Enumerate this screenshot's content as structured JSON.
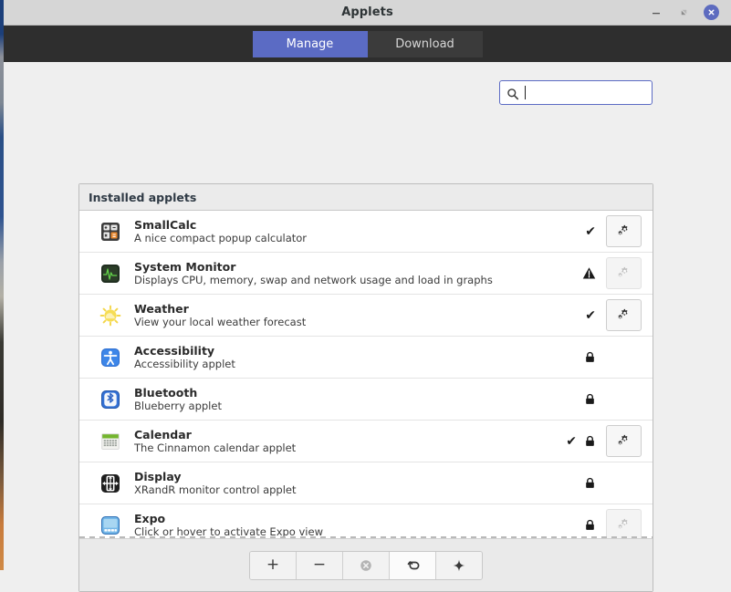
{
  "window": {
    "title": "Applets",
    "controls": {
      "minimize": "minimize",
      "maximize": "maximize",
      "close": "close"
    }
  },
  "tabs": [
    {
      "label": "Manage",
      "active": true
    },
    {
      "label": "Download",
      "active": false
    }
  ],
  "search": {
    "placeholder": "",
    "value": "",
    "icon": "search-icon",
    "focused": true
  },
  "panel": {
    "header": "Installed applets",
    "rows": [
      {
        "name": "SmallCalc",
        "description": "A nice compact popup calculator",
        "icon": "calculator-icon",
        "checked": true,
        "warning": false,
        "locked": false,
        "gear": "enabled"
      },
      {
        "name": "System Monitor",
        "description": "Displays CPU, memory, swap and network usage and load in graphs",
        "icon": "system-monitor-icon",
        "checked": false,
        "warning": true,
        "locked": false,
        "gear": "disabled"
      },
      {
        "name": "Weather",
        "description": "View your local weather forecast",
        "icon": "weather-sun-icon",
        "checked": true,
        "warning": false,
        "locked": false,
        "gear": "enabled"
      },
      {
        "name": "Accessibility",
        "description": "Accessibility applet",
        "icon": "accessibility-icon",
        "checked": false,
        "warning": false,
        "locked": true,
        "gear": "none"
      },
      {
        "name": "Bluetooth",
        "description": "Blueberry applet",
        "icon": "bluetooth-icon",
        "checked": false,
        "warning": false,
        "locked": true,
        "gear": "none"
      },
      {
        "name": "Calendar",
        "description": "The Cinnamon calendar applet",
        "icon": "calendar-icon",
        "checked": true,
        "warning": false,
        "locked": true,
        "gear": "enabled"
      },
      {
        "name": "Display",
        "description": "XRandR monitor control applet",
        "icon": "display-icon",
        "checked": false,
        "warning": false,
        "locked": true,
        "gear": "none"
      },
      {
        "name": "Expo",
        "description": "Click or hover to activate Expo view",
        "icon": "expo-icon",
        "checked": false,
        "warning": false,
        "locked": true,
        "gear": "disabled"
      }
    ]
  },
  "toolbar": {
    "buttons": [
      {
        "name": "add-applet-button",
        "icon": "plus-icon",
        "glyph": "+",
        "state": "normal"
      },
      {
        "name": "remove-applet-button",
        "icon": "minus-icon",
        "glyph": "−",
        "state": "normal"
      },
      {
        "name": "uninstall-applet-button",
        "icon": "circle-x-icon",
        "glyph": "",
        "state": "disabled"
      },
      {
        "name": "restore-defaults-button",
        "icon": "undo-arrow-icon",
        "glyph": "",
        "state": "hover"
      },
      {
        "name": "highlight-applet-button",
        "icon": "sparkle-icon",
        "glyph": "",
        "state": "normal"
      }
    ]
  },
  "colors": {
    "accent": "#5b6bc4",
    "tabbar": "#2e2e2e",
    "titlebar": "#d6d6d6",
    "content_bg": "#efefef",
    "panel_bg": "#ffffff"
  }
}
